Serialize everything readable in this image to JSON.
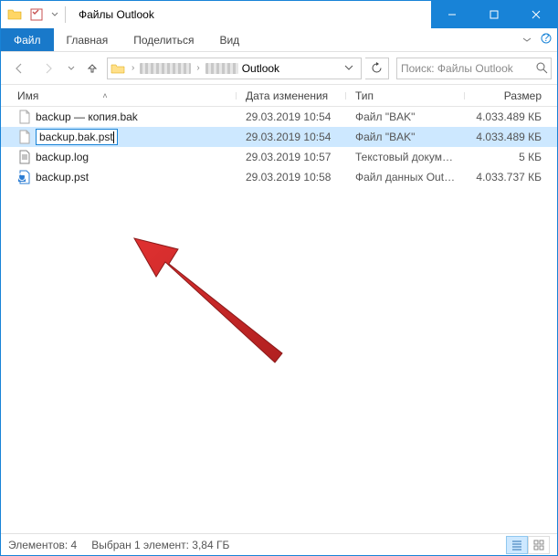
{
  "window": {
    "title": "Файлы Outlook"
  },
  "ribbon": {
    "file": "Файл",
    "tabs": [
      "Главная",
      "Поделиться",
      "Вид"
    ]
  },
  "address": {
    "current": "Outlook"
  },
  "search": {
    "placeholder": "Поиск: Файлы Outlook"
  },
  "columns": {
    "name": "Имя",
    "date": "Дата изменения",
    "type": "Тип",
    "size": "Размер"
  },
  "files": [
    {
      "name": "backup — копия.bak",
      "date": "29.03.2019 10:54",
      "type": "Файл \"BAK\"",
      "size": "4.033.489 КБ",
      "icon": "file"
    },
    {
      "name": "backup.bak.pst",
      "date": "29.03.2019 10:54",
      "type": "Файл \"BAK\"",
      "size": "4.033.489 КБ",
      "icon": "file",
      "renaming": true,
      "selected": true
    },
    {
      "name": "backup.log",
      "date": "29.03.2019 10:57",
      "type": "Текстовый докум…",
      "size": "5 КБ",
      "icon": "text"
    },
    {
      "name": "backup.pst",
      "date": "29.03.2019 10:58",
      "type": "Файл данных Out…",
      "size": "4.033.737 КБ",
      "icon": "pst"
    }
  ],
  "status": {
    "count": "Элементов: 4",
    "selection": "Выбран 1 элемент: 3,84 ГБ"
  }
}
